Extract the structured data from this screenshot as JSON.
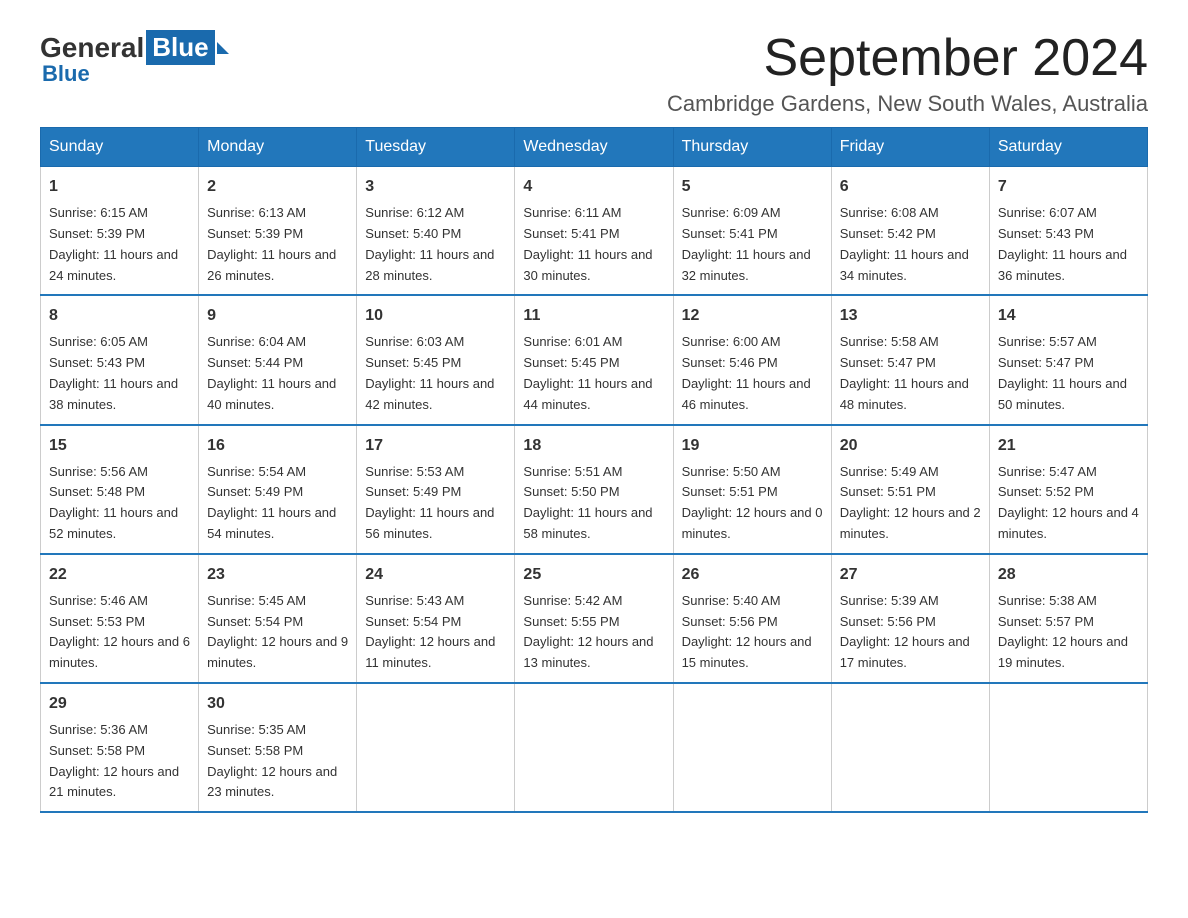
{
  "header": {
    "logo_general": "General",
    "logo_blue": "Blue",
    "month_title": "September 2024",
    "location": "Cambridge Gardens, New South Wales, Australia"
  },
  "days_of_week": [
    "Sunday",
    "Monday",
    "Tuesday",
    "Wednesday",
    "Thursday",
    "Friday",
    "Saturday"
  ],
  "weeks": [
    [
      {
        "day": "1",
        "sunrise": "6:15 AM",
        "sunset": "5:39 PM",
        "daylight": "11 hours and 24 minutes."
      },
      {
        "day": "2",
        "sunrise": "6:13 AM",
        "sunset": "5:39 PM",
        "daylight": "11 hours and 26 minutes."
      },
      {
        "day": "3",
        "sunrise": "6:12 AM",
        "sunset": "5:40 PM",
        "daylight": "11 hours and 28 minutes."
      },
      {
        "day": "4",
        "sunrise": "6:11 AM",
        "sunset": "5:41 PM",
        "daylight": "11 hours and 30 minutes."
      },
      {
        "day": "5",
        "sunrise": "6:09 AM",
        "sunset": "5:41 PM",
        "daylight": "11 hours and 32 minutes."
      },
      {
        "day": "6",
        "sunrise": "6:08 AM",
        "sunset": "5:42 PM",
        "daylight": "11 hours and 34 minutes."
      },
      {
        "day": "7",
        "sunrise": "6:07 AM",
        "sunset": "5:43 PM",
        "daylight": "11 hours and 36 minutes."
      }
    ],
    [
      {
        "day": "8",
        "sunrise": "6:05 AM",
        "sunset": "5:43 PM",
        "daylight": "11 hours and 38 minutes."
      },
      {
        "day": "9",
        "sunrise": "6:04 AM",
        "sunset": "5:44 PM",
        "daylight": "11 hours and 40 minutes."
      },
      {
        "day": "10",
        "sunrise": "6:03 AM",
        "sunset": "5:45 PM",
        "daylight": "11 hours and 42 minutes."
      },
      {
        "day": "11",
        "sunrise": "6:01 AM",
        "sunset": "5:45 PM",
        "daylight": "11 hours and 44 minutes."
      },
      {
        "day": "12",
        "sunrise": "6:00 AM",
        "sunset": "5:46 PM",
        "daylight": "11 hours and 46 minutes."
      },
      {
        "day": "13",
        "sunrise": "5:58 AM",
        "sunset": "5:47 PM",
        "daylight": "11 hours and 48 minutes."
      },
      {
        "day": "14",
        "sunrise": "5:57 AM",
        "sunset": "5:47 PM",
        "daylight": "11 hours and 50 minutes."
      }
    ],
    [
      {
        "day": "15",
        "sunrise": "5:56 AM",
        "sunset": "5:48 PM",
        "daylight": "11 hours and 52 minutes."
      },
      {
        "day": "16",
        "sunrise": "5:54 AM",
        "sunset": "5:49 PM",
        "daylight": "11 hours and 54 minutes."
      },
      {
        "day": "17",
        "sunrise": "5:53 AM",
        "sunset": "5:49 PM",
        "daylight": "11 hours and 56 minutes."
      },
      {
        "day": "18",
        "sunrise": "5:51 AM",
        "sunset": "5:50 PM",
        "daylight": "11 hours and 58 minutes."
      },
      {
        "day": "19",
        "sunrise": "5:50 AM",
        "sunset": "5:51 PM",
        "daylight": "12 hours and 0 minutes."
      },
      {
        "day": "20",
        "sunrise": "5:49 AM",
        "sunset": "5:51 PM",
        "daylight": "12 hours and 2 minutes."
      },
      {
        "day": "21",
        "sunrise": "5:47 AM",
        "sunset": "5:52 PM",
        "daylight": "12 hours and 4 minutes."
      }
    ],
    [
      {
        "day": "22",
        "sunrise": "5:46 AM",
        "sunset": "5:53 PM",
        "daylight": "12 hours and 6 minutes."
      },
      {
        "day": "23",
        "sunrise": "5:45 AM",
        "sunset": "5:54 PM",
        "daylight": "12 hours and 9 minutes."
      },
      {
        "day": "24",
        "sunrise": "5:43 AM",
        "sunset": "5:54 PM",
        "daylight": "12 hours and 11 minutes."
      },
      {
        "day": "25",
        "sunrise": "5:42 AM",
        "sunset": "5:55 PM",
        "daylight": "12 hours and 13 minutes."
      },
      {
        "day": "26",
        "sunrise": "5:40 AM",
        "sunset": "5:56 PM",
        "daylight": "12 hours and 15 minutes."
      },
      {
        "day": "27",
        "sunrise": "5:39 AM",
        "sunset": "5:56 PM",
        "daylight": "12 hours and 17 minutes."
      },
      {
        "day": "28",
        "sunrise": "5:38 AM",
        "sunset": "5:57 PM",
        "daylight": "12 hours and 19 minutes."
      }
    ],
    [
      {
        "day": "29",
        "sunrise": "5:36 AM",
        "sunset": "5:58 PM",
        "daylight": "12 hours and 21 minutes."
      },
      {
        "day": "30",
        "sunrise": "5:35 AM",
        "sunset": "5:58 PM",
        "daylight": "12 hours and 23 minutes."
      },
      null,
      null,
      null,
      null,
      null
    ]
  ]
}
